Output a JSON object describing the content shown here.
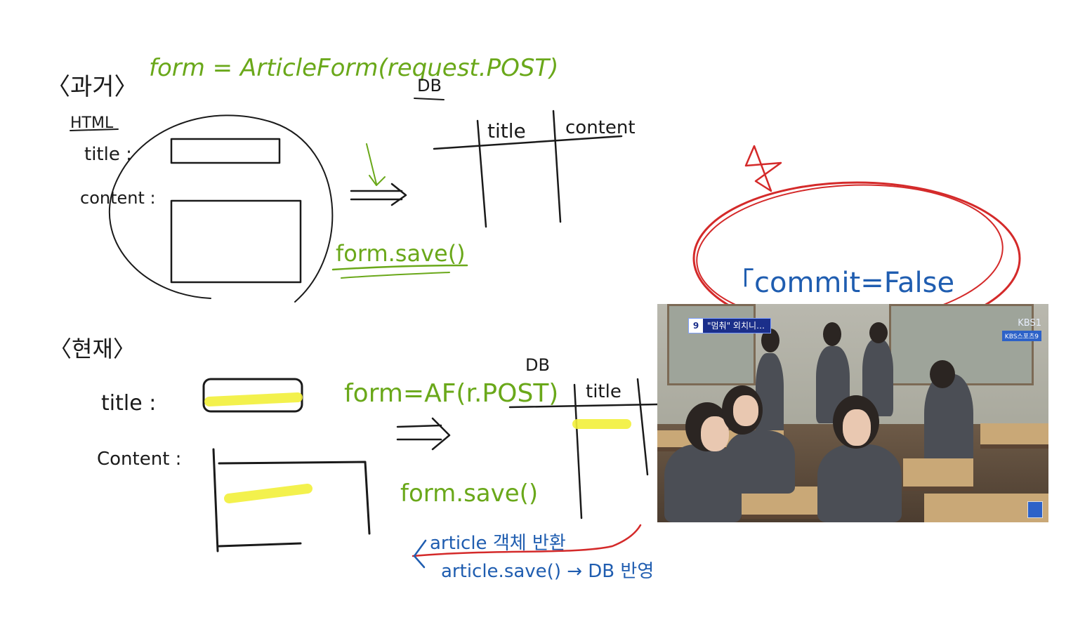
{
  "top": {
    "past_label": "〈과거〉",
    "code": "form = ArticleForm(request.POST)",
    "html_label": "HTML",
    "title_label": "title :",
    "content_label": "content :",
    "db_label": "DB",
    "col_title": "title",
    "col_content": "content",
    "save": "form.save()"
  },
  "bottom": {
    "present_label": "〈현재〉",
    "title_label": "title :",
    "content_label": "Content :",
    "code": "form=AF(r.POST)",
    "db_label": "DB",
    "col_title": "title",
    "save": "form.save()"
  },
  "notes": {
    "commit": "「commit=False",
    "line1": "article 객체 반환",
    "line2": "article.save() → DB 반영"
  },
  "video": {
    "ticker_num": "9",
    "ticker_text": "\"멈춰\" 외치니…",
    "channel": "KBS1",
    "program": "KBS스포츠9"
  },
  "colors": {
    "black_ink": "#1a1a1a",
    "green_ink": "#6aa81a",
    "blue_ink": "#1f5db0",
    "red_ink": "#d42a2a",
    "highlight": "#f2f03a"
  }
}
